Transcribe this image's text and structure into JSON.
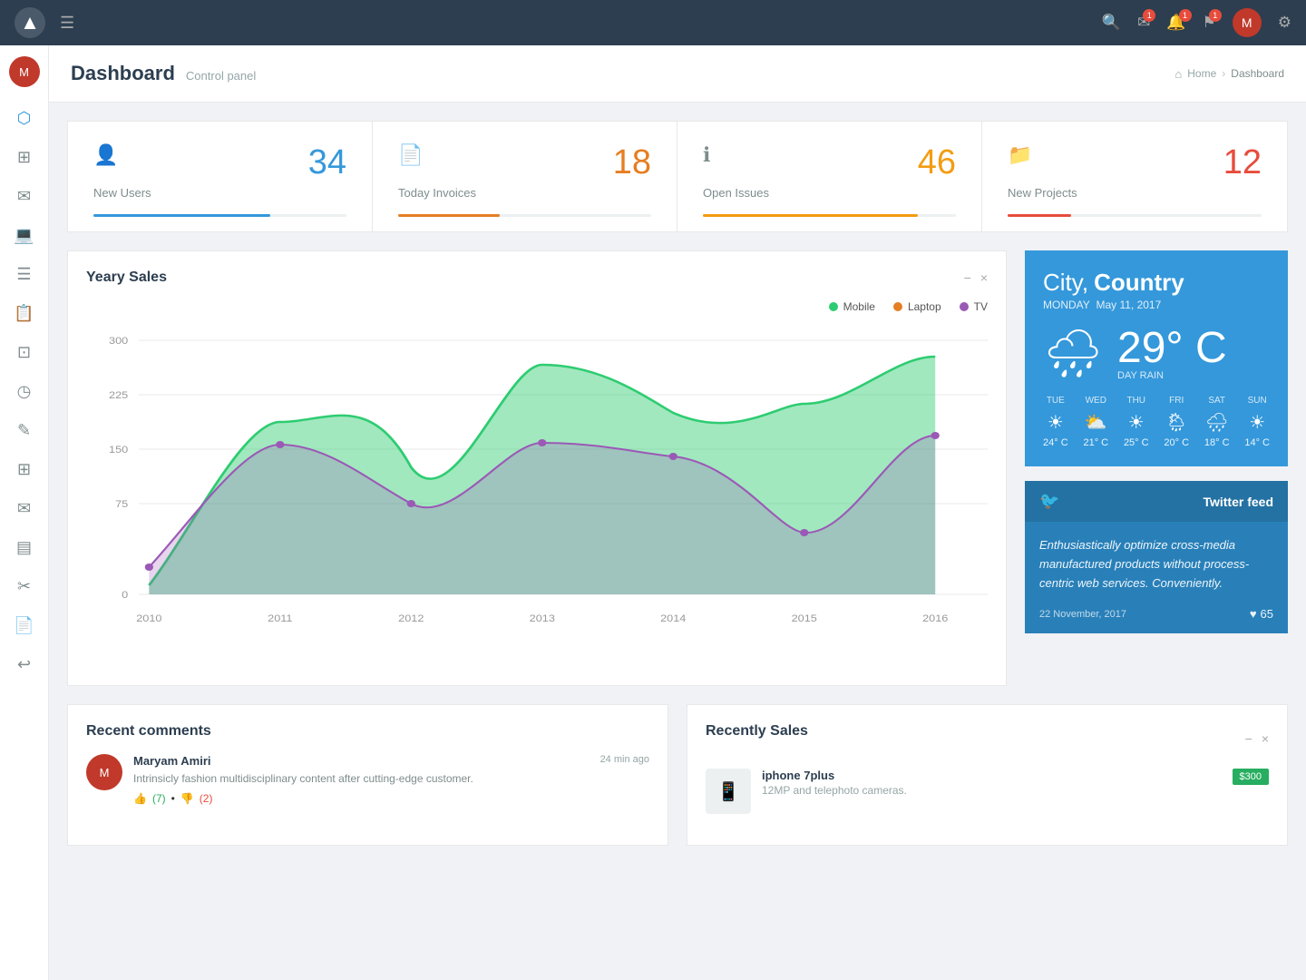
{
  "topnav": {
    "logo": "▲",
    "hamburger": "☰",
    "search_icon": "🔍",
    "mail_icon": "✉",
    "bell_icon": "🔔",
    "flag_icon": "⚑",
    "gear_icon": "⚙",
    "mail_badge": "1",
    "bell_badge": "1",
    "flag_badge": "1"
  },
  "sidebar": {
    "items": [
      {
        "icon": "⬡",
        "name": "dashboard"
      },
      {
        "icon": "⊞",
        "name": "grid"
      },
      {
        "icon": "✉",
        "name": "mail"
      },
      {
        "icon": "☰",
        "name": "list"
      },
      {
        "icon": "✏",
        "name": "edit"
      },
      {
        "icon": "⊡",
        "name": "box"
      },
      {
        "icon": "◷",
        "name": "clock"
      },
      {
        "icon": "✎",
        "name": "note"
      },
      {
        "icon": "⊞",
        "name": "table"
      },
      {
        "icon": "✉",
        "name": "envelope"
      },
      {
        "icon": "▤",
        "name": "bar-chart"
      },
      {
        "icon": "✂",
        "name": "tool"
      },
      {
        "icon": "⊟",
        "name": "document"
      },
      {
        "icon": "↩",
        "name": "share"
      }
    ]
  },
  "breadcrumb": {
    "home": "Home",
    "current": "Dashboard",
    "icon": "⌂"
  },
  "page": {
    "title": "Dashboard",
    "subtitle": "Control panel"
  },
  "stats": [
    {
      "icon": "👤",
      "number": "34",
      "label": "New Users",
      "color": "#3498db",
      "bar_color": "#3498db",
      "bar_width": "70%"
    },
    {
      "icon": "📄",
      "number": "18",
      "label": "Today Invoices",
      "color": "#e67e22",
      "bar_color": "#e67e22",
      "bar_width": "40%"
    },
    {
      "icon": "ℹ",
      "number": "46",
      "label": "Open Issues",
      "color": "#f39c12",
      "bar_color": "#f39c12",
      "bar_width": "85%"
    },
    {
      "icon": "📁",
      "number": "12",
      "label": "New Projects",
      "color": "#e74c3c",
      "bar_color": "#e74c3c",
      "bar_width": "25%"
    }
  ],
  "chart": {
    "title": "Yeary Sales",
    "minimize": "−",
    "close": "×",
    "legend": [
      {
        "label": "Mobile",
        "color": "#2ecc71"
      },
      {
        "label": "Laptop",
        "color": "#e67e22"
      },
      {
        "label": "TV",
        "color": "#9b59b6"
      }
    ],
    "y_labels": [
      "300",
      "225",
      "150",
      "75",
      "0"
    ],
    "x_labels": [
      "2010",
      "2011",
      "2012",
      "2013",
      "2014",
      "2015",
      "2016"
    ]
  },
  "weather": {
    "city": "City,",
    "country": "Country",
    "day": "MONDAY",
    "date": "May 11, 2017",
    "temp": "29°",
    "unit": "C",
    "condition": "DAY RAIN",
    "icon": "🌧",
    "forecast": [
      {
        "day": "TUE",
        "icon": "☀",
        "temp": "24° C"
      },
      {
        "day": "WED",
        "icon": "⛅",
        "temp": "21° C"
      },
      {
        "day": "THU",
        "icon": "☀",
        "temp": "25° C"
      },
      {
        "day": "FRI",
        "icon": "🌦",
        "temp": "20° C"
      },
      {
        "day": "SAT",
        "icon": "🌧",
        "temp": "18° C"
      },
      {
        "day": "SUN",
        "icon": "☀",
        "temp": "14° C"
      }
    ]
  },
  "twitter": {
    "title": "Twitter feed",
    "icon": "🐦",
    "text": "Enthusiastically optimize cross-media manufactured products without process-centric web services. Conveniently.",
    "date": "22 November, 2017",
    "likes": "65",
    "heart_icon": "♥"
  },
  "recent_comments": {
    "title": "Recent comments",
    "items": [
      {
        "author": "Maryam Amiri",
        "time": "24 min ago",
        "text": "Intrinsicly fashion multidisciplinary content after cutting-edge customer.",
        "thumbs_up": "7",
        "thumbs_down": "2",
        "avatar_initial": "M"
      }
    ]
  },
  "recently_sales": {
    "title": "Recently Sales",
    "minimize": "−",
    "close": "×",
    "items": [
      {
        "name": "iphone 7plus",
        "desc": "12MP and telephoto cameras.",
        "price": "$300",
        "price_color": "#27ae60",
        "emoji": "📱"
      }
    ]
  }
}
